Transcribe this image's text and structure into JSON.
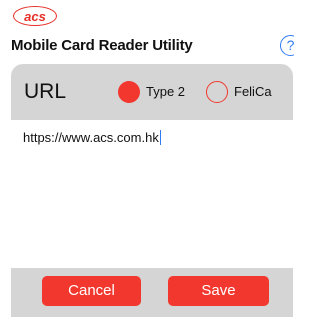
{
  "header": {
    "logo_text": "acs",
    "title": "Mobile Card Reader Utility",
    "help_icon": "?"
  },
  "dialog": {
    "label": "URL",
    "options": [
      {
        "label": "Type 2",
        "selected": true
      },
      {
        "label": "FeliCa",
        "selected": false
      }
    ],
    "url_value": "https://www.acs.com.hk",
    "cancel_label": "Cancel",
    "save_label": "Save"
  },
  "colors": {
    "accent": "#f2382e",
    "help_blue": "#2f7bf5",
    "dialog_bg": "#d5d5d5"
  }
}
